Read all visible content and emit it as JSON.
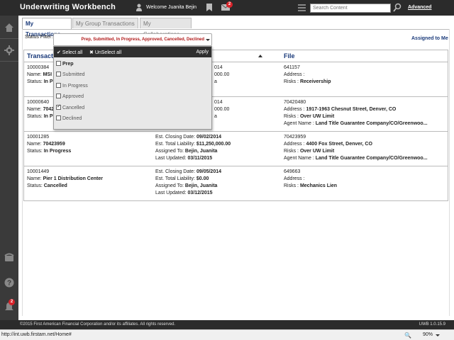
{
  "header": {
    "title": "Underwriting Workbench",
    "welcome": "Welcome Juanita Bejin",
    "mail_count": "2",
    "search_placeholder": "Search Content",
    "advanced_label": "Advanced"
  },
  "tabs": [
    {
      "label": "My Transactions",
      "active": true
    },
    {
      "label": "My Group Transactions",
      "active": false
    },
    {
      "label": "My Collaborations",
      "active": false
    }
  ],
  "filter": {
    "label": "Status Filter:",
    "value": "Prep, Submitted, In Progress, Approved, Cancelled, Declined",
    "assigned_link": "Assigned to Me"
  },
  "dropdown": {
    "select_all": "Select all",
    "unselect_all": "UnSelect all",
    "apply": "Apply",
    "options": [
      {
        "label": "Prep",
        "checked": false
      },
      {
        "label": "Submitted",
        "checked": false
      },
      {
        "label": "In Progress",
        "checked": false
      },
      {
        "label": "Approved",
        "checked": false
      },
      {
        "label": "Cancelled",
        "checked": true
      },
      {
        "label": "Declined",
        "checked": false
      }
    ]
  },
  "table": {
    "headers": [
      "Transaction",
      "File"
    ],
    "rows": [
      {
        "c1": [
          "10000384",
          "Name: MSI ",
          "Status: In Progre"
        ],
        "c1_label": [
          "",
          "Name: ",
          "Status: "
        ],
        "c1_value": [
          "10000384",
          "MSI ",
          "In Progre"
        ],
        "c2": [
          "014",
          "000.00",
          "a"
        ],
        "c3_label": [
          "",
          "Address : ",
          "Risks : "
        ],
        "c3_value": [
          "641157",
          "",
          "Receivership"
        ]
      },
      {
        "c1_label": [
          "",
          "Name: ",
          "Status: "
        ],
        "c1_value": [
          "10000640",
          "7042",
          "In Prog"
        ],
        "c2": [
          "014",
          "000.00",
          "a"
        ],
        "c3_label": [
          "",
          "Address : ",
          "Risks : ",
          "Agent Name : "
        ],
        "c3_value": [
          "70420480",
          "1917-1963 Chesnut Street, Denver, CO",
          "Over UW Limit",
          "Land Title Guarantee Company/CO/Greenwoo..."
        ]
      },
      {
        "c1_label": [
          "",
          "Name: ",
          "Status: "
        ],
        "c1_value": [
          "10001285",
          "70423959",
          "In Progress"
        ],
        "c2_label": [
          "Est. Closing Date: ",
          "Est. Total Liability: ",
          "Assigned To: ",
          "Last Updated: "
        ],
        "c2_value": [
          "09/02/2014",
          "$11,250,000.00",
          "Bejin, Juanita",
          "03/11/2015"
        ],
        "c3_label": [
          "",
          "Address : ",
          "Risks : ",
          "Agent Name : "
        ],
        "c3_value": [
          "70423959",
          "4400 Fox Street, Denver, CO",
          "Over UW Limit",
          "Land Title Guarantee Company/CO/Greenwoo..."
        ]
      },
      {
        "c1_label": [
          "",
          "Name: ",
          "Status: "
        ],
        "c1_value": [
          "10001449",
          "Pier 1 Distribution Center",
          "Cancelled"
        ],
        "c2_label": [
          "Est. Closing Date: ",
          "Est. Total Liability: ",
          "Assigned To: ",
          "Last Updated: "
        ],
        "c2_value": [
          "09/05/2014",
          "$0.00",
          "Bejin, Juanita",
          "03/12/2015"
        ],
        "c3_label": [
          "",
          "Address : ",
          "Risks : "
        ],
        "c3_value": [
          "649663",
          "",
          "Mechanics Lien"
        ]
      }
    ]
  },
  "rail": {
    "notif_count": "2"
  },
  "footer": {
    "copyright": "©2015 First American Financial Corporation and/or its affiliates. All rights reserved.",
    "version": "UWB 1.0.15.9"
  },
  "statusbar": {
    "url": "http://int.uwb.firstam.net/Home#",
    "zoom": "90%"
  },
  "colors": {
    "accent": "#1a3a7a",
    "filter_text": "#b01818",
    "header_bg": "#2b2b2b",
    "badge": "#d8232a"
  }
}
